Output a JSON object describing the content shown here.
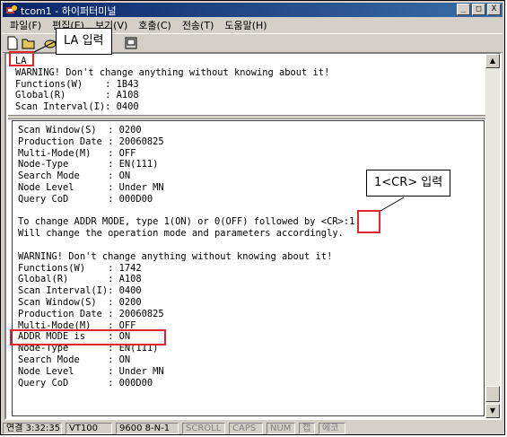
{
  "window": {
    "title": "tcom1 - 하이퍼터미널",
    "controls": {
      "minimize": "_",
      "maximize": "□",
      "close": "X"
    }
  },
  "menu": [
    "파일(F)",
    "편집(E)",
    "보기(V)",
    "호출(C)",
    "전송(T)",
    "도움말(H)"
  ],
  "toolbar": [
    "new-icon",
    "open-icon",
    "connect-icon",
    "properties-icon"
  ],
  "terminal": {
    "upper_lines": "LA\nWARNING! Don't change anything without knowing about it!\nFunctions(W)    : 1B43\nGlobal(R)       : A108\nScan Interval(I): 0400",
    "lower_lines": "Scan Window(S)  : 0200\nProduction Date : 20060825\nMulti-Mode(M)   : OFF\nNode-Type       : EN(111)\nSearch Mode     : ON\nNode Level      : Under MN\nQuery CoD       : 000D00\n\nTo change ADDR MODE, type 1(ON) or 0(OFF) followed by <CR>:1\nWill change the operation mode and parameters accordingly.\n\nWARNING! Don't change anything without knowing about it!\nFunctions(W)    : 1742\nGlobal(R)       : A108\nScan Interval(I): 0400\nScan Window(S)  : 0200\nProduction Date : 20060825\nMulti-Mode(M)   : OFF\nADDR MODE is    : ON\nNode-Type       : EN(111)\nSearch Mode     : ON\nNode Level      : Under MN\nQuery CoD       : 000D00"
  },
  "annotations": {
    "la_input": "LA 입력",
    "cr_input": "1<CR> 입력",
    "highlight_color": "#e3262b"
  },
  "statusbar": [
    "연결 3:32:35",
    "VT100",
    "9600 8-N-1",
    "SCROLL",
    "CAPS",
    "NUM",
    "캡",
    "에코"
  ]
}
